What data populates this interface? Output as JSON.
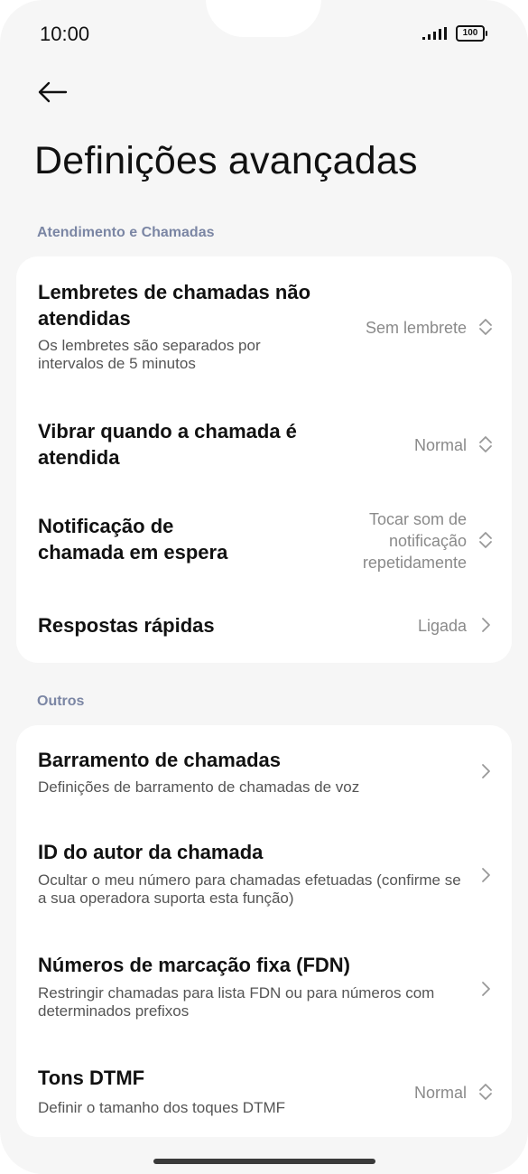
{
  "status": {
    "time": "10:00",
    "battery": "100"
  },
  "page": {
    "title": "Definições avançadas"
  },
  "sections": {
    "calls": {
      "label": "Atendimento e Chamadas",
      "rows": [
        {
          "title": "Lembretes de chamadas não atendidas",
          "subtitle": "Os lembretes são separados por intervalos de 5 minutos",
          "value": "Sem lembrete"
        },
        {
          "title": "Vibrar quando a chamada é atendida",
          "value": "Normal"
        },
        {
          "title": "Notificação de chamada em espera",
          "value": "Tocar som de notificação repetidamente"
        },
        {
          "title": "Respostas rápidas",
          "value": "Ligada"
        }
      ]
    },
    "others": {
      "label": "Outros",
      "rows": [
        {
          "title": "Barramento de chamadas",
          "subtitle": "Definições de barramento de chamadas de voz"
        },
        {
          "title": "ID do autor da chamada",
          "subtitle": "Ocultar o meu número para chamadas efetuadas (confirme se a sua operadora suporta esta função)"
        },
        {
          "title": "Números de marcação fixa (FDN)",
          "subtitle": "Restringir chamadas para lista FDN ou para números com determinados prefixos"
        },
        {
          "title": "Tons DTMF",
          "subtitle": "Definir o tamanho dos toques DTMF",
          "value": "Normal"
        }
      ]
    }
  }
}
